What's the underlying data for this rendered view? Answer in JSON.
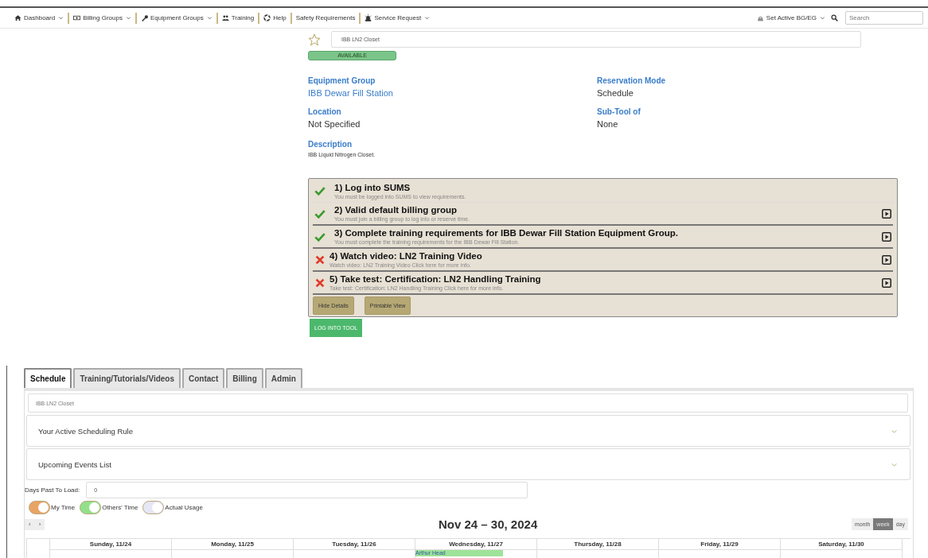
{
  "nav": {
    "left": [
      {
        "label": "Dashboard",
        "dropdown": true
      },
      {
        "label": "Billing Groups",
        "dropdown": true
      },
      {
        "label": "Equipment Groups",
        "dropdown": true
      },
      {
        "label": "Training",
        "dropdown": false
      },
      {
        "label": "Help",
        "dropdown": false
      },
      {
        "label": "Safety Requirements",
        "dropdown": false
      },
      {
        "label": "Service Request",
        "dropdown": true
      }
    ],
    "right": {
      "label": "Set Active BG/EG",
      "dropdown": true
    },
    "search": {
      "placeholder": "Search"
    }
  },
  "tool": {
    "favorite": false,
    "name": "IBB LN2 Closet",
    "status": "AVAILABLE"
  },
  "details": [
    {
      "label": "Equipment Group",
      "value": "IBB Dewar Fill Station",
      "link": true
    },
    {
      "label": "Reservation Mode",
      "value": "Schedule",
      "link": false
    },
    {
      "label": "Location",
      "value": "Not Specified",
      "link": false
    },
    {
      "label": "Sub-Tool of",
      "value": "None",
      "link": false
    }
  ],
  "description": {
    "label": "Description",
    "text": "IBB Liquid Nitrogen Closet."
  },
  "requirements": {
    "items": [
      {
        "met": true,
        "title": "1) Log into SUMS",
        "detail": "You must be logged into SUMS to view requirements.",
        "play": false
      },
      {
        "met": true,
        "title": "2) Valid default billing group",
        "detail": "You must join a billing group to log into or reserve time.",
        "play": true
      },
      {
        "met": true,
        "title": "3) Complete training requirements for IBB Dewar Fill Station Equipment Group.",
        "detail": "You must complete the training requirements for the IBB Dewar Fill Station.",
        "play": true
      },
      {
        "met": false,
        "title": "4) Watch video: LN2 Training Video",
        "detail": "Watch video: LN2 Training Video Click here for more info.",
        "play": true
      },
      {
        "met": false,
        "title": "5) Take test: Certification: LN2 Handling Training",
        "detail": "Take test: Certification: LN2 Handling Training Click here for more info.",
        "play": true
      }
    ],
    "buttons": [
      "Hide Details",
      "Printable View"
    ]
  },
  "login_button": "LOG INTO TOOL",
  "tabs": [
    {
      "label": "Schedule",
      "selected": true
    },
    {
      "label": "Training/Tutorials/Videos",
      "selected": false
    },
    {
      "label": "Contact",
      "selected": false
    },
    {
      "label": "Billing",
      "selected": false
    },
    {
      "label": "Admin",
      "selected": false
    }
  ],
  "schedule": {
    "tool_name": "IBB LN2 Closet",
    "panels": [
      {
        "title": "Your Active Scheduling Rule",
        "expanded": false
      },
      {
        "title": "Upcoming Events List",
        "expanded": false
      }
    ],
    "days_past": {
      "label": "Days Past To Load:",
      "value": "0"
    },
    "toggles": [
      {
        "label": "My Time",
        "on": true,
        "color": "#e8a464"
      },
      {
        "label": "Others' Time",
        "on": true,
        "color": "#93e08a"
      },
      {
        "label": "Actual Usage",
        "on": true,
        "color": "#e6e6f5"
      }
    ],
    "nav_buttons": [
      "‹",
      "›"
    ],
    "title": "Nov 24 – 30, 2024",
    "views": [
      {
        "label": "month",
        "selected": false
      },
      {
        "label": "week",
        "selected": true
      },
      {
        "label": "day",
        "selected": false
      }
    ],
    "days": [
      {
        "label": "Sunday, 11/24"
      },
      {
        "label": "Monday, 11/25"
      },
      {
        "label": "Tuesday, 11/26"
      },
      {
        "label": "Wednesday, 11/27",
        "events": [
          {
            "label": "Arthur Head",
            "color": "#9ee39a"
          }
        ]
      },
      {
        "label": "Thursday, 11/28"
      },
      {
        "label": "Friday, 11/29"
      },
      {
        "label": "Saturday, 11/30"
      }
    ]
  }
}
